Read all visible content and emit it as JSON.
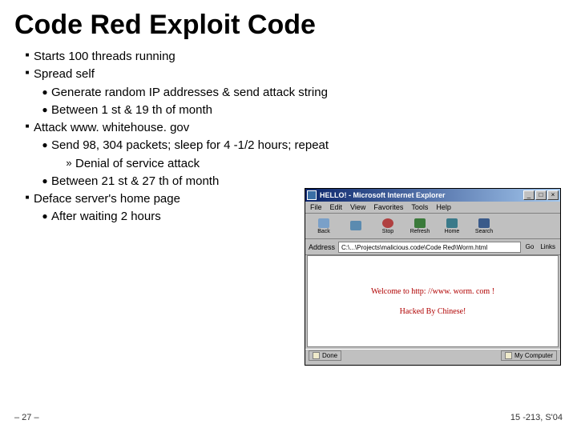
{
  "title": "Code Red Exploit Code",
  "bullets": {
    "b1": "Starts 100 threads running",
    "b2": "Spread self",
    "b2a": "Generate random IP addresses & send attack string",
    "b2b": "Between 1 st & 19 th of month",
    "b3": "Attack www. whitehouse. gov",
    "b3a": "Send 98, 304 packets; sleep for 4 -1/2 hours; repeat",
    "b3a1": "Denial of service attack",
    "b3b": "Between 21 st & 27 th of month",
    "b4": "Deface server's home page",
    "b4a": "After waiting 2 hours"
  },
  "footer": {
    "left": "– 27 –",
    "right": "15 -213, S'04"
  },
  "browser": {
    "title": "HELLO! - Microsoft Internet Explorer",
    "menu": {
      "file": "File",
      "edit": "Edit",
      "view": "View",
      "favorites": "Favorites",
      "tools": "Tools",
      "help": "Help"
    },
    "toolbar": {
      "back": "Back",
      "stop": "Stop",
      "refresh": "Refresh",
      "home": "Home",
      "search": "Search"
    },
    "address_label": "Address",
    "address_value": "C:\\...\\Projects\\malicious.code\\Code Red\\Worm.html",
    "go": "Go",
    "links": "Links",
    "page_line1": "Welcome to http: //www. worm. com !",
    "page_line2": "Hacked By Chinese!",
    "status_left": "Done",
    "status_right": "My Computer"
  }
}
